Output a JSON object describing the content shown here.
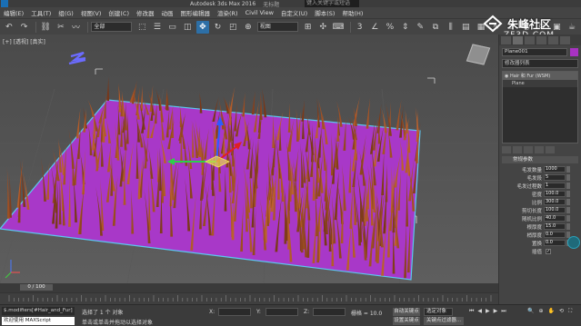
{
  "titlebar": {
    "title": "Autodesk 3ds Max 2016",
    "project": "无标题",
    "search_placeholder": "键入关键字或短语"
  },
  "menubar": {
    "items": [
      "编辑(E)",
      "工具(T)",
      "组(G)",
      "视图(V)",
      "创建(C)",
      "修改器",
      "动画",
      "图形编辑器",
      "渲染(R)",
      "Civil View",
      "自定义(U)",
      "脚本(S)",
      "帮助(H)"
    ],
    "workspace": "工作区: 默认"
  },
  "toolbar": {
    "selection_filter": "全部",
    "view_select": "视图"
  },
  "viewport": {
    "label": "[+] [透视] [真实]",
    "accent_plane": "#a838c8",
    "grass_color": "#8a5a2a"
  },
  "watermark": {
    "text": "朱峰社区",
    "sub": "ZF3D.COM"
  },
  "cmdpanel": {
    "object_name": "Plane001",
    "object_color": "#a832c2",
    "modifier_list": "修改器列表",
    "stack": [
      {
        "label": "Hair 和 Fur (WSM)",
        "selected": true
      },
      {
        "label": "Plane",
        "selected": false
      }
    ],
    "rollout_title": "常规参数",
    "params": [
      {
        "label": "毛发数量",
        "value": "1000"
      },
      {
        "label": "毛发段",
        "value": "5"
      },
      {
        "label": "毛发过程数",
        "value": "1"
      },
      {
        "label": "密度",
        "value": "100.0"
      },
      {
        "label": "比例",
        "value": "300.0"
      },
      {
        "label": "剪切长度",
        "value": "100.0"
      },
      {
        "label": "随机比例",
        "value": "40.0"
      },
      {
        "label": "根厚度",
        "value": "15.0"
      },
      {
        "label": "梢厚度",
        "value": "0.0"
      },
      {
        "label": "置换",
        "value": "0.0"
      }
    ],
    "interp_label": "插值",
    "interp_check": "✓"
  },
  "timeline": {
    "frame": "0 / 100"
  },
  "statusbar": {
    "listener1": "$.modifiers[#Hair_and_Fur]",
    "listener2": "欢迎使用 MAXScript",
    "selected": "选择了 1 个 对象",
    "hint": "单击或单击并拖动以选择对象",
    "x_label": "X:",
    "y_label": "Y:",
    "z_label": "Z:",
    "grid": "栅格 = 10.0",
    "autokey": "自动关键点",
    "selected_set": "选定对象",
    "setkey": "设置关键点",
    "filter": "关键点过滤器..."
  }
}
